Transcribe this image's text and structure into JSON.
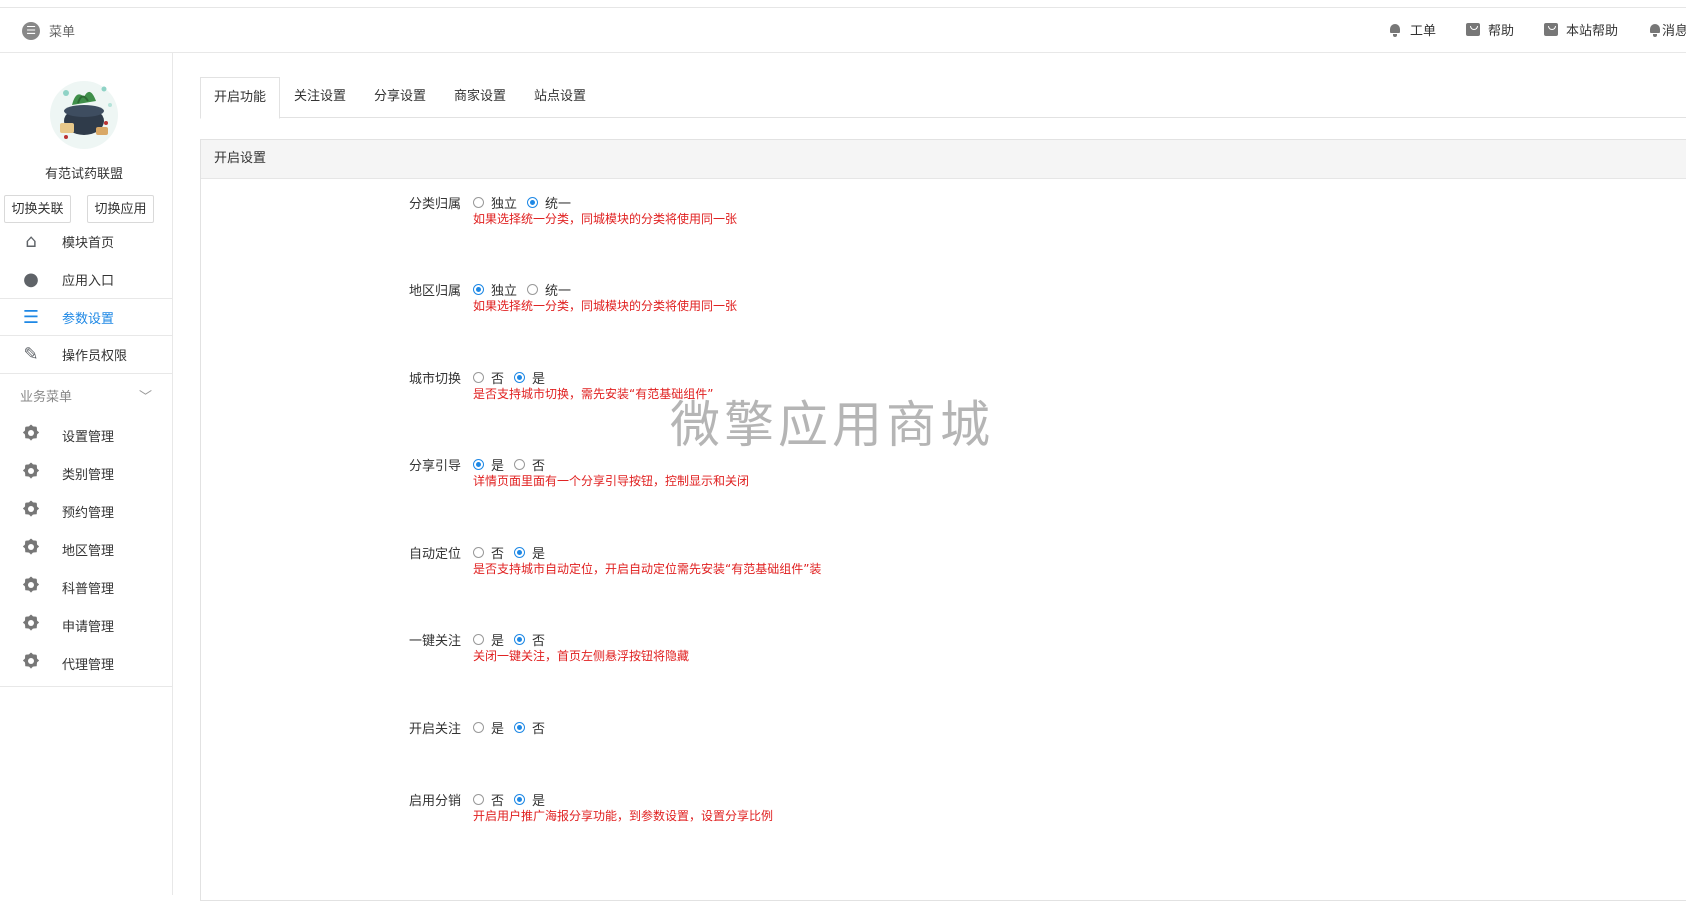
{
  "header": {
    "menu_label": "菜单",
    "links": [
      {
        "icon": "bell-icon",
        "label": "工单"
      },
      {
        "icon": "bag-icon",
        "label": "帮助"
      },
      {
        "icon": "bag-icon",
        "label": "本站帮助"
      },
      {
        "icon": "bell-icon",
        "label": "消息"
      }
    ]
  },
  "sidebar": {
    "app_name": "有范试药联盟",
    "switch_link": "切换关联",
    "switch_app": "切换应用",
    "items": [
      {
        "label": "模块首页",
        "icon": "home-icon"
      },
      {
        "label": "应用入口",
        "icon": "chat-icon"
      },
      {
        "label": "参数设置",
        "icon": "list-icon",
        "active": true
      },
      {
        "label": "操作员权限",
        "icon": "edit-doc-icon"
      }
    ],
    "group_title": "业务菜单",
    "group_items": [
      {
        "label": "设置管理"
      },
      {
        "label": "类别管理"
      },
      {
        "label": "预约管理"
      },
      {
        "label": "地区管理"
      },
      {
        "label": "科普管理"
      },
      {
        "label": "申请管理"
      },
      {
        "label": "代理管理"
      }
    ]
  },
  "tabs": [
    {
      "label": "开启功能",
      "active": true
    },
    {
      "label": "关注设置"
    },
    {
      "label": "分享设置"
    },
    {
      "label": "商家设置"
    },
    {
      "label": "站点设置"
    }
  ],
  "panel": {
    "title": "开启设置",
    "rows": [
      {
        "label": "分类归属",
        "options": [
          "独立",
          "统一"
        ],
        "selected": 1,
        "hint": "如果选择统一分类，同城模块的分类将使用同一张"
      },
      {
        "label": "地区归属",
        "options": [
          "独立",
          "统一"
        ],
        "selected": 0,
        "hint": "如果选择统一分类，同城模块的分类将使用同一张"
      },
      {
        "label": "城市切换",
        "options": [
          "否",
          "是"
        ],
        "selected": 1,
        "hint": "是否支持城市切换，需先安装“有范基础组件”"
      },
      {
        "label": "分享引导",
        "options": [
          "是",
          "否"
        ],
        "selected": 0,
        "hint": "详情页面里面有一个分享引导按钮，控制显示和关闭"
      },
      {
        "label": "自动定位",
        "options": [
          "否",
          "是"
        ],
        "selected": 1,
        "hint": "是否支持城市自动定位，开启自动定位需先安装“有范基础组件”装"
      },
      {
        "label": "一键关注",
        "options": [
          "是",
          "否"
        ],
        "selected": 1,
        "hint": "关闭一键关注，首页左侧悬浮按钮将隐藏"
      },
      {
        "label": "开启关注",
        "options": [
          "是",
          "否"
        ],
        "selected": 1,
        "hint": ""
      },
      {
        "label": "启用分销",
        "options": [
          "否",
          "是"
        ],
        "selected": 1,
        "hint": "开启用户推广海报分享功能，到参数设置，设置分享比例"
      }
    ]
  },
  "watermark": "微擎应用商城"
}
